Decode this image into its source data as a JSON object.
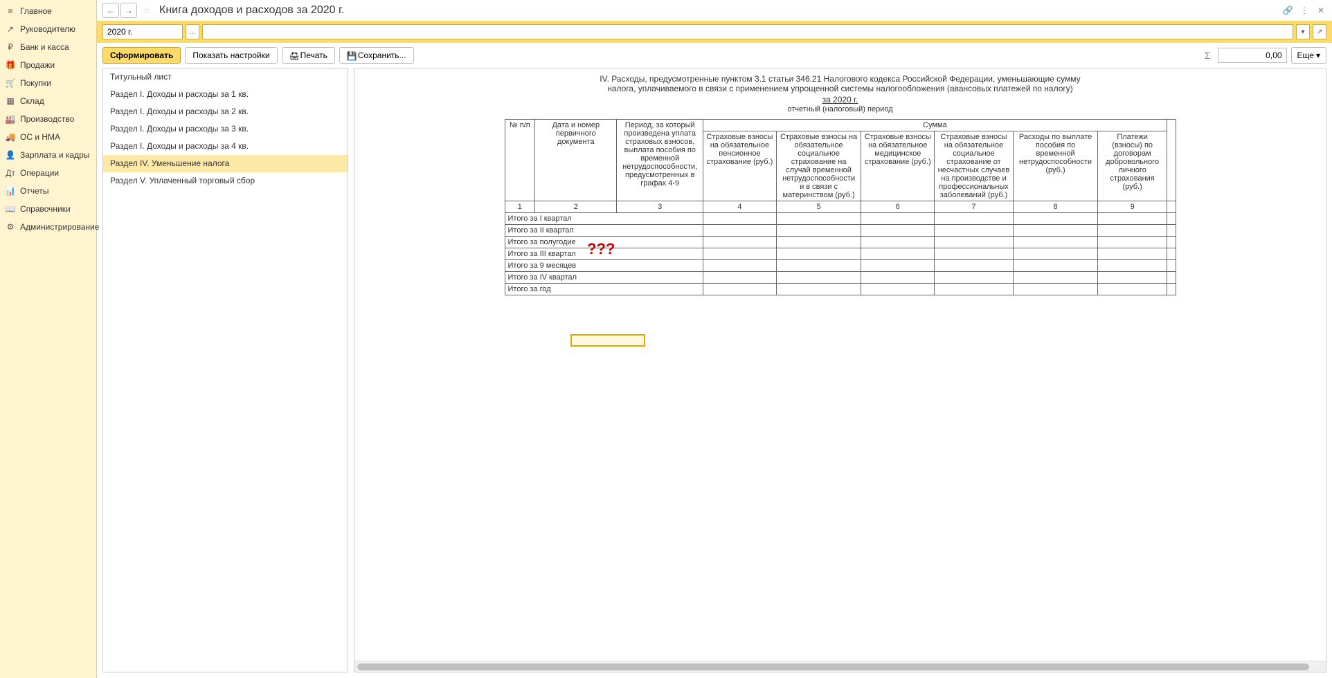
{
  "nav": {
    "items": [
      {
        "label": "Главное"
      },
      {
        "label": "Руководителю"
      },
      {
        "label": "Банк и касса"
      },
      {
        "label": "Продажи"
      },
      {
        "label": "Покупки"
      },
      {
        "label": "Склад"
      },
      {
        "label": "Производство"
      },
      {
        "label": "ОС и НМА"
      },
      {
        "label": "Зарплата и кадры"
      },
      {
        "label": "Операции"
      },
      {
        "label": "Отчеты"
      },
      {
        "label": "Справочники"
      },
      {
        "label": "Администрирование"
      }
    ]
  },
  "header": {
    "title": "Книга доходов и расходов за 2020 г."
  },
  "params": {
    "period": "2020 г."
  },
  "toolbar": {
    "generate": "Сформировать",
    "show_settings": "Показать настройки",
    "print": "Печать",
    "save": "Сохранить...",
    "sum_value": "0,00",
    "more": "Еще"
  },
  "sections": {
    "items": [
      {
        "label": "Титульный лист"
      },
      {
        "label": "Раздел I. Доходы и расходы за 1 кв."
      },
      {
        "label": "Раздел I. Доходы и расходы за 2 кв."
      },
      {
        "label": "Раздел I. Доходы и расходы за 3 кв."
      },
      {
        "label": "Раздел I. Доходы и расходы за 4 кв."
      },
      {
        "label": "Раздел IV. Уменьшение налога"
      },
      {
        "label": "Раздел V. Уплаченный торговый сбор"
      }
    ],
    "selected_index": 5
  },
  "report": {
    "title_line1": "IV. Расходы, предусмотренные пунктом 3.1 статьи 346.21 Налогового кодекса Российской Федерации, уменьшающие сумму",
    "title_line2": "налога, уплачиваемого в связи с применением упрощенной системы налогообложения (авансовых платежей по налогу)",
    "period_text": "за 2020 г.",
    "period_sub": "отчетный (налоговый) период",
    "columns": {
      "c1": "№ п/п",
      "c2": "Дата и номер первичного документа",
      "c3": "Период, за который произведена уплата страховых взносов, выплата пособия по временной нетрудоспособности, предусмотренных в графах 4-9",
      "sum_header": "Сумма",
      "c4": "Страховые взносы на обязательное пенсионное страхование (руб.)",
      "c5": "Страховые взносы на обязательное социальное страхование на случай временной нетрудоспособности и в связи с материнством (руб.)",
      "c6": "Страховые взносы на обязательное медицинское страхование (руб.)",
      "c7": "Страховые взносы на обязательное социальное страхование от несчастных случаев на производстве и профессиональных заболеваний (руб.)",
      "c8": "Расходы по выплате пособия по временной нетрудоспособности (руб.)",
      "c9": "Платежи (взносы) по договорам добровольного личного страхования (руб.)"
    },
    "col_nums": [
      "1",
      "2",
      "3",
      "4",
      "5",
      "6",
      "7",
      "8",
      "9"
    ],
    "rows": [
      {
        "label": "Итого за I квартал"
      },
      {
        "label": "Итого за II квартал"
      },
      {
        "label": "Итого за полугодие"
      },
      {
        "label": "Итого за III квартал"
      },
      {
        "label": "Итого за 9 месяцев"
      },
      {
        "label": "Итого за IV квартал"
      },
      {
        "label": "Итого за год"
      }
    ],
    "annotation": "???"
  }
}
